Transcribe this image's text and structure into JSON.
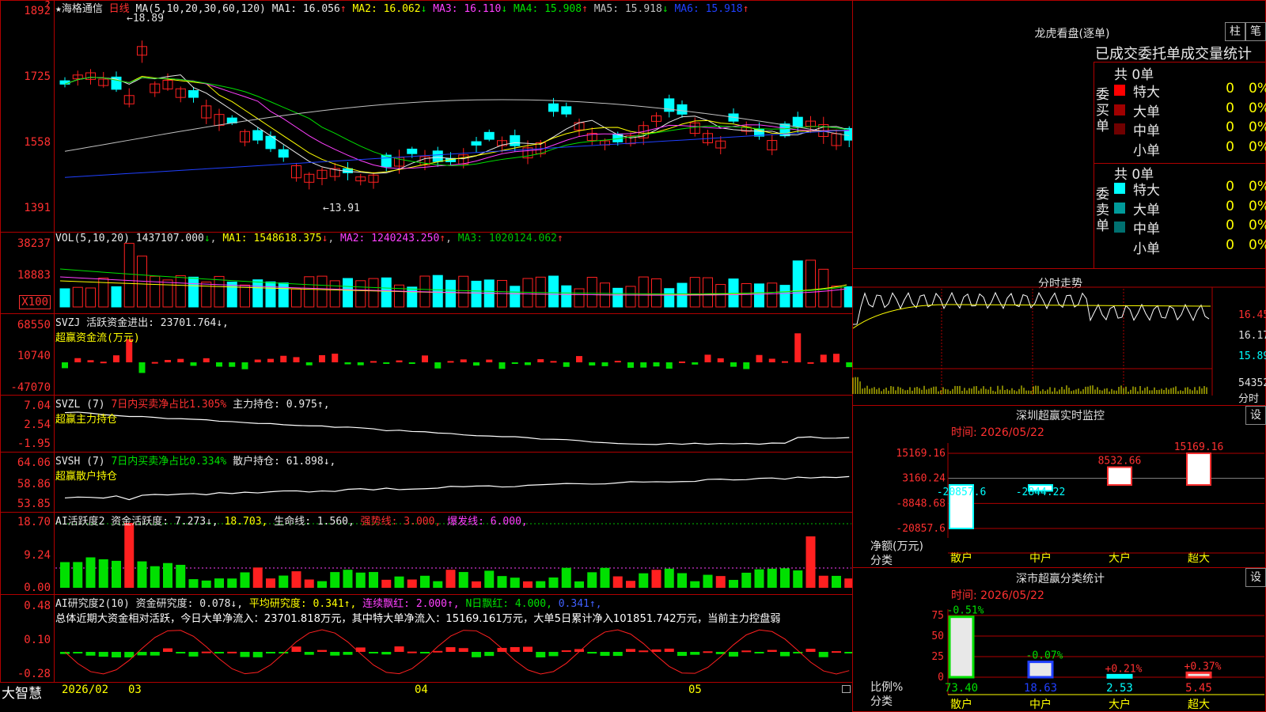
{
  "stock": {
    "name": "海格通信",
    "period": "日线",
    "ma_label": "MA(5,10,20,30,60,120)",
    "ma": [
      {
        "label": "MA1:",
        "value": "16.056",
        "arrow": "↑",
        "color": "#e8e8e8"
      },
      {
        "label": "MA2:",
        "value": "16.062",
        "arrow": "↓",
        "color": "#ffff00"
      },
      {
        "label": "MA3:",
        "value": "16.110",
        "arrow": "↓",
        "color": "#ff40ff"
      },
      {
        "label": "MA4:",
        "value": "15.908",
        "arrow": "↑",
        "color": "#00e000"
      },
      {
        "label": "MA5:",
        "value": "15.918",
        "arrow": "↓",
        "color": "#c0c0c0"
      },
      {
        "label": "MA6:",
        "value": "15.918",
        "arrow": "↑",
        "color": "#2040ff"
      }
    ],
    "price_axis": [
      "1892",
      "1725",
      "1558",
      "1391"
    ],
    "high_mark": "18.89",
    "low_mark": "13.91"
  },
  "vol": {
    "header": "VOL(5,10,20)",
    "value": "1437107.000",
    "value_arrow": "↓",
    "ma1": "MA1: 1548618.375",
    "ma2": "MA2: 1240243.250",
    "ma3": "MA3: 1020124.062",
    "axis": [
      "38237",
      "18883"
    ],
    "unit": "X100"
  },
  "svzj": {
    "header": "SVZJ  活跃资金进出: 23701.764↓,",
    "sub": "超赢资金流(万元)",
    "axis": [
      "68550",
      "10740",
      "-47070"
    ]
  },
  "svzl": {
    "header_a": "SVZL (7)",
    "header_b": "7日内买卖净占比1.305%",
    "header_c": "主力持仓: 0.975↑,",
    "sub": "超赢主力持仓",
    "axis": [
      "7.04",
      "2.54",
      "-1.95"
    ]
  },
  "svsh": {
    "header_a": "SVSH (7)",
    "header_b": "7日内买卖净占比0.334%",
    "header_c": "散户持仓: 61.898↓,",
    "sub": "超赢散户持仓",
    "axis": [
      "64.06",
      "58.86",
      "53.85"
    ]
  },
  "ai_active": {
    "header_a": "AI活跃度2 资金活跃度: 7.273↓,",
    "header_b": "18.703,",
    "header_c": "生命线: 1.560,",
    "header_d": "强势线: 3.000,",
    "header_e": "爆发线: 6.000,",
    "axis": [
      "18.70",
      "9.24",
      "0.00"
    ]
  },
  "ai_research": {
    "header_a": "AI研究度2(10) 资金研究度: 0.078↓,",
    "header_b": "平均研究度: 0.341↑,",
    "header_c": "连续飘红: 2.000↑,",
    "header_d": "N日飘红: 4.000,",
    "header_e": "0.341↑,",
    "summary": "总体近期大资金相对活跃，今日大单净流入：23701.818万元，其中特大单净流入：15169.161万元，大单5日累计净入101851.742万元，当前主力控盘弱",
    "axis": [
      "0.48",
      "0.10",
      "-0.28"
    ]
  },
  "bottom": {
    "brand": "大智慧",
    "dates": [
      "2026/02",
      "03",
      "04",
      "05"
    ]
  },
  "lhb": {
    "title": "龙虎看盘(逐单)",
    "btn_zhu": "柱",
    "btn_bi": "笔",
    "caption": "已成交委托单成交量统计",
    "buy": {
      "side": "委买单",
      "total": "共 0单",
      "rows": [
        {
          "label": "特大",
          "val": "0",
          "pct": "0%",
          "color": "#ff0000"
        },
        {
          "label": "大单",
          "val": "0",
          "pct": "0%",
          "color": "#a00000"
        },
        {
          "label": "中单",
          "val": "0",
          "pct": "0%",
          "color": "#700000"
        },
        {
          "label": "小单",
          "val": "0",
          "pct": "0%",
          "color": ""
        }
      ]
    },
    "sell": {
      "side": "委卖单",
      "total": "共 0单",
      "rows": [
        {
          "label": "特大",
          "val": "0",
          "pct": "0%",
          "color": "#00ffff"
        },
        {
          "label": "大单",
          "val": "0",
          "pct": "0%",
          "color": "#009a9a"
        },
        {
          "label": "中单",
          "val": "0",
          "pct": "0%",
          "color": "#007070"
        },
        {
          "label": "小单",
          "val": "0",
          "pct": "0%",
          "color": ""
        }
      ]
    }
  },
  "fenshi": {
    "title": "分时走势",
    "axis": [
      "16.45",
      "16.17",
      "15.89"
    ],
    "vol_label": "54352",
    "vol_unit": "分时"
  },
  "sz_monitor": {
    "title": "深圳超赢实时监控",
    "btn": "设",
    "time": "时间: 2026/05/22",
    "axis": [
      "15169.16",
      "3160.24",
      "-8848.68",
      "-20857.6"
    ],
    "ylabel_a": "净额(万元)",
    "ylabel_b": "分类",
    "categories": [
      "散户",
      "中户",
      "大户",
      "超大"
    ],
    "bar_labels": [
      "-20857.6",
      "-2844.22",
      "8532.66",
      "15169.16"
    ]
  },
  "sz_class": {
    "title": "深市超赢分类统计",
    "btn": "设",
    "time": "时间: 2026/05/22",
    "axis": [
      "75",
      "50",
      "25",
      "0"
    ],
    "ylabel_a": "比例%",
    "ylabel_b": "分类",
    "categories": [
      "散户",
      "中户",
      "大户",
      "超大"
    ],
    "changes": [
      "-0.51%",
      "-0.07%",
      "+0.21%",
      "+0.37%"
    ],
    "values": [
      "73.40",
      "18.63",
      "2.53",
      "5.45"
    ]
  },
  "chart_data": [
    {
      "type": "bar",
      "title": "深圳超赢实时监控",
      "categories": [
        "散户",
        "中户",
        "大户",
        "超大"
      ],
      "values": [
        -20857.6,
        -2844.22,
        8532.66,
        15169.16
      ],
      "ylabel": "净额(万元)",
      "ylim": [
        -20857.6,
        15169.16
      ]
    },
    {
      "type": "bar",
      "title": "深市超赢分类统计",
      "categories": [
        "散户",
        "中户",
        "大户",
        "超大"
      ],
      "values": [
        73.4,
        18.63,
        2.53,
        5.45
      ],
      "ylabel": "比例%",
      "ylim": [
        0,
        75
      ]
    }
  ]
}
